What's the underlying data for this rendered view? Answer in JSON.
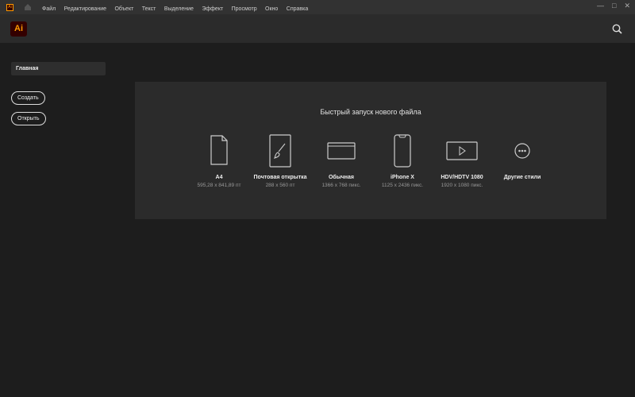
{
  "titlebar": {
    "app_icon": "Ai",
    "menu": [
      "Файл",
      "Редактирование",
      "Объект",
      "Текст",
      "Выделение",
      "Эффект",
      "Просмотр",
      "Окно",
      "Справка"
    ]
  },
  "header": {
    "logo": "Ai"
  },
  "sidebar": {
    "home": "Главная",
    "create": "Создать",
    "open": "Открыть"
  },
  "quickstart": {
    "title": "Быстрый запуск нового файла",
    "presets": [
      {
        "name": "A4",
        "size": "595,28 x 841,89 пт",
        "icon": "document-icon"
      },
      {
        "name": "Почтовая открытка",
        "size": "288 x 560 пт",
        "icon": "brush-icon"
      },
      {
        "name": "Обычная",
        "size": "1366 x 768 пикс.",
        "icon": "browser-window-icon"
      },
      {
        "name": "iPhone X",
        "size": "1125 x 2436 пикс.",
        "icon": "phone-icon"
      },
      {
        "name": "HDV/HDTV 1080",
        "size": "1920 x 1080 пикс.",
        "icon": "video-icon"
      },
      {
        "name": "Другие стили",
        "icon": "more-icon"
      }
    ]
  }
}
